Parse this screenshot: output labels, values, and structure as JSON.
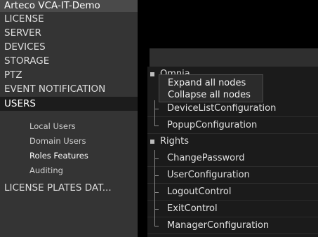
{
  "sidebar": {
    "app_title": "Arteco VCA-IT-Demo",
    "items": [
      {
        "label": "LICENSE"
      },
      {
        "label": "SERVER"
      },
      {
        "label": "DEVICES"
      },
      {
        "label": "STORAGE"
      },
      {
        "label": "PTZ"
      },
      {
        "label": "EVENT NOTIFICATION"
      },
      {
        "label": "USERS"
      },
      {
        "label": "LICENSE PLATES DAT..."
      }
    ],
    "users_subitems": [
      {
        "label": "Local Users"
      },
      {
        "label": "Domain Users"
      },
      {
        "label": "Roles Features"
      },
      {
        "label": "Auditing"
      }
    ],
    "active_item": "USERS",
    "selected_subitem": "Roles Features"
  },
  "tree": {
    "groups": [
      {
        "label": "Omnia",
        "children": [
          "DeviceListConfiguration",
          "PopupConfiguration"
        ]
      },
      {
        "label": "Rights",
        "children": [
          "ChangePassword",
          "UserConfiguration",
          "LogoutControl",
          "ExitControl",
          "ManagerConfiguration"
        ]
      }
    ]
  },
  "context_menu": {
    "items": [
      {
        "label": "Expand all nodes"
      },
      {
        "label": "Collapse all nodes"
      }
    ]
  }
}
